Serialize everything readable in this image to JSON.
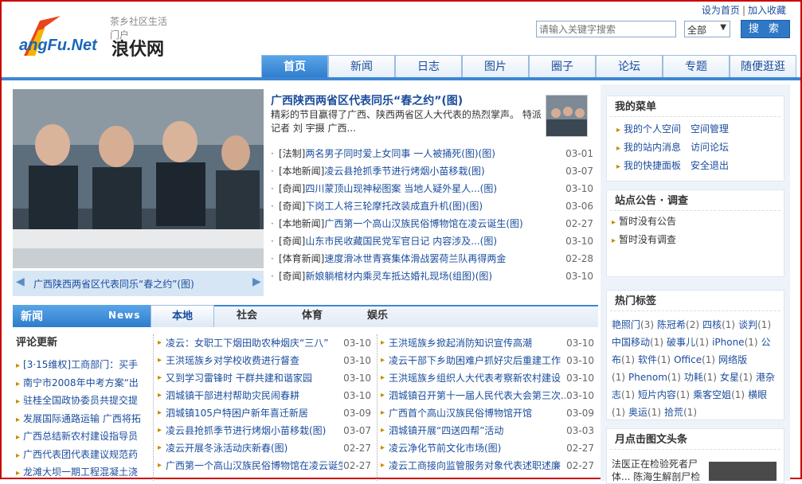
{
  "header": {
    "slogan": "茶乡社区生活门户",
    "logo_word": "angFu.Net",
    "logo_cn": "浪伏网",
    "toplinks": [
      "设为首页",
      "加入收藏"
    ],
    "search_placeholder": "请输入关键字搜索",
    "search_scope": "全部",
    "search_button": "搜 索"
  },
  "nav": [
    "首页",
    "新闻",
    "日志",
    "图片",
    "圈子",
    "论坛",
    "专题",
    "随便逛逛"
  ],
  "feature": {
    "caption": "广西陕西两省区代表同乐“春之约”(图)"
  },
  "headline": {
    "title": "广西陕西两省区代表同乐“春之约”(图)",
    "summary": "精彩的节目赢得了广西、陕西两省区人大代表的热烈掌声。 特派记者 刘 宇摄 广西..."
  },
  "news": [
    {
      "cat": "[法制]",
      "title": "两名男子同时爱上女同事 一人被捅死(图)(图)",
      "date": "03-01"
    },
    {
      "cat": "[本地新闻]",
      "title": "凌云县抢抓季节进行烤烟小苗移栽(图)",
      "date": "03-07"
    },
    {
      "cat": "[奇闻]",
      "title": "四川蒙顶山现神秘图案 当地人疑外星人...(图)",
      "date": "03-10"
    },
    {
      "cat": "[奇闻]",
      "title": "下岗工人将三轮摩托改装成直升机(图)(图)",
      "date": "03-06"
    },
    {
      "cat": "[本地新闻]",
      "title": "广西第一个高山汉族民俗博物馆在凌云诞生(图)",
      "date": "02-27"
    },
    {
      "cat": "[奇闻]",
      "title": "山东市民收藏国民党军官日记 内容涉及...(图)",
      "date": "03-10"
    },
    {
      "cat": "[体育新闻]",
      "title": "速度滑冰世青赛集体滑战罢荷兰队再得两金",
      "date": "02-28"
    },
    {
      "cat": "[奇闻]",
      "title": "新娘躺棺材内乘灵车抵达婚礼现场(组图)(图)",
      "date": "03-10"
    }
  ],
  "right": {
    "menu_title": "我的菜单",
    "menu": [
      [
        "我的个人空间",
        "空间管理"
      ],
      [
        "我的站内消息",
        "访问论坛"
      ],
      [
        "我的快捷面板",
        "安全退出"
      ]
    ],
    "notice_title": "站点公告 · 调查",
    "notices": [
      "暂时没有公告",
      "暂时没有调查"
    ],
    "tags_title": "热门标签",
    "tags": [
      [
        "艳照门",
        "3"
      ],
      [
        "陈冠希",
        "2"
      ],
      [
        "四核",
        "1"
      ],
      [
        "谈判",
        "1"
      ],
      [
        "中国移动",
        "1"
      ],
      [
        "破事儿",
        "1"
      ],
      [
        "iPhone",
        "1"
      ],
      [
        "公布",
        "1"
      ],
      [
        "软件",
        "1"
      ],
      [
        "Office",
        "1"
      ],
      [
        "网络版",
        "1"
      ],
      [
        "Phenom",
        "1"
      ],
      [
        "功耗",
        "1"
      ],
      [
        "女星",
        "1"
      ],
      [
        "港杂志",
        "1"
      ],
      [
        "短片内容",
        "1"
      ],
      [
        "乘客空姐",
        "1"
      ],
      [
        "横眼",
        "1"
      ],
      [
        "奥运",
        "1"
      ],
      [
        "拾荒",
        "1"
      ]
    ],
    "hotimg_title": "月点击图文头条",
    "hotimg_text": "法医正在检验死者尸体... 陈海生解剖尸检"
  },
  "news_tabs": {
    "cn": "新闻",
    "en": "News",
    "tabs": [
      "本地",
      "社会",
      "体育",
      "娱乐"
    ]
  },
  "comments": {
    "title": "评论更新",
    "items": [
      "[3·15维权]工商部门：买手",
      "南宁市2008年中考方案“出",
      "驻桂全国政协委员共提交提",
      "发展国际通路运输 广西将拓",
      "广西总结新农村建设指导员",
      "广西代表团代表建议规范药",
      "龙滩大坝一期工程混凝土浇"
    ]
  },
  "col1": [
    {
      "t": "凌云：女职工下烟田助农种烟庆“三八”",
      "d": "03-10"
    },
    {
      "t": "王洪瑶族乡对学校收费进行督查",
      "d": "03-10"
    },
    {
      "t": "又到学习雷锋时 干群共建和谐家园",
      "d": "03-10"
    },
    {
      "t": "泗城镇干部进村帮助灾民闹春耕",
      "d": "03-10"
    },
    {
      "t": "泗城镇105户特困户新年喜迁新居",
      "d": "03-09"
    },
    {
      "t": "凌云县抢抓季节进行烤烟小苗移栽(图)",
      "d": "03-07"
    },
    {
      "t": "凌云开展冬泳活动庆新春(图)",
      "d": "02-27"
    },
    {
      "t": "广西第一个高山汉族民俗博物馆在凌云诞生",
      "d": "02-27"
    }
  ],
  "col2": [
    {
      "t": "王洪瑶族乡掀起消防知识宣传高潮",
      "d": "03-10"
    },
    {
      "t": "凌云干部下乡助困难户抓好灾后重建工作",
      "d": "03-10"
    },
    {
      "t": "王洪瑶族乡组织人大代表考察新农村建设",
      "d": "03-10"
    },
    {
      "t": "泗城镇召开第十一届人民代表大会第三次...",
      "d": "03-10"
    },
    {
      "t": "广西首个高山汉族民俗博物馆开馆",
      "d": "03-09"
    },
    {
      "t": "泗城镇开展“四送四帮”活动",
      "d": "03-03"
    },
    {
      "t": "凌云净化节前文化市场(图)",
      "d": "02-27"
    },
    {
      "t": "凌云工商接向监管服务对象代表述职述廉",
      "d": "02-27"
    }
  ]
}
